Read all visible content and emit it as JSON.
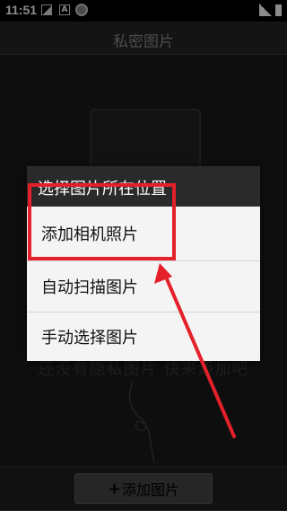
{
  "status_bar": {
    "time": "11:51",
    "font_icon_letter": "A",
    "icons": [
      "image-icon",
      "font-icon",
      "app-icon",
      "signal-icon",
      "battery-icon"
    ]
  },
  "app": {
    "title": "私密图片",
    "empty_message": "还没有隐私图片 快来添加吧",
    "add_button": {
      "plus": "+",
      "label": "添加图片"
    }
  },
  "dialog": {
    "title": "选择图片所在位置",
    "options": [
      {
        "label": "添加相机照片"
      },
      {
        "label": "自动扫描图片"
      },
      {
        "label": "手动选择图片"
      }
    ]
  },
  "annotation": {
    "color": "#e4202a"
  }
}
